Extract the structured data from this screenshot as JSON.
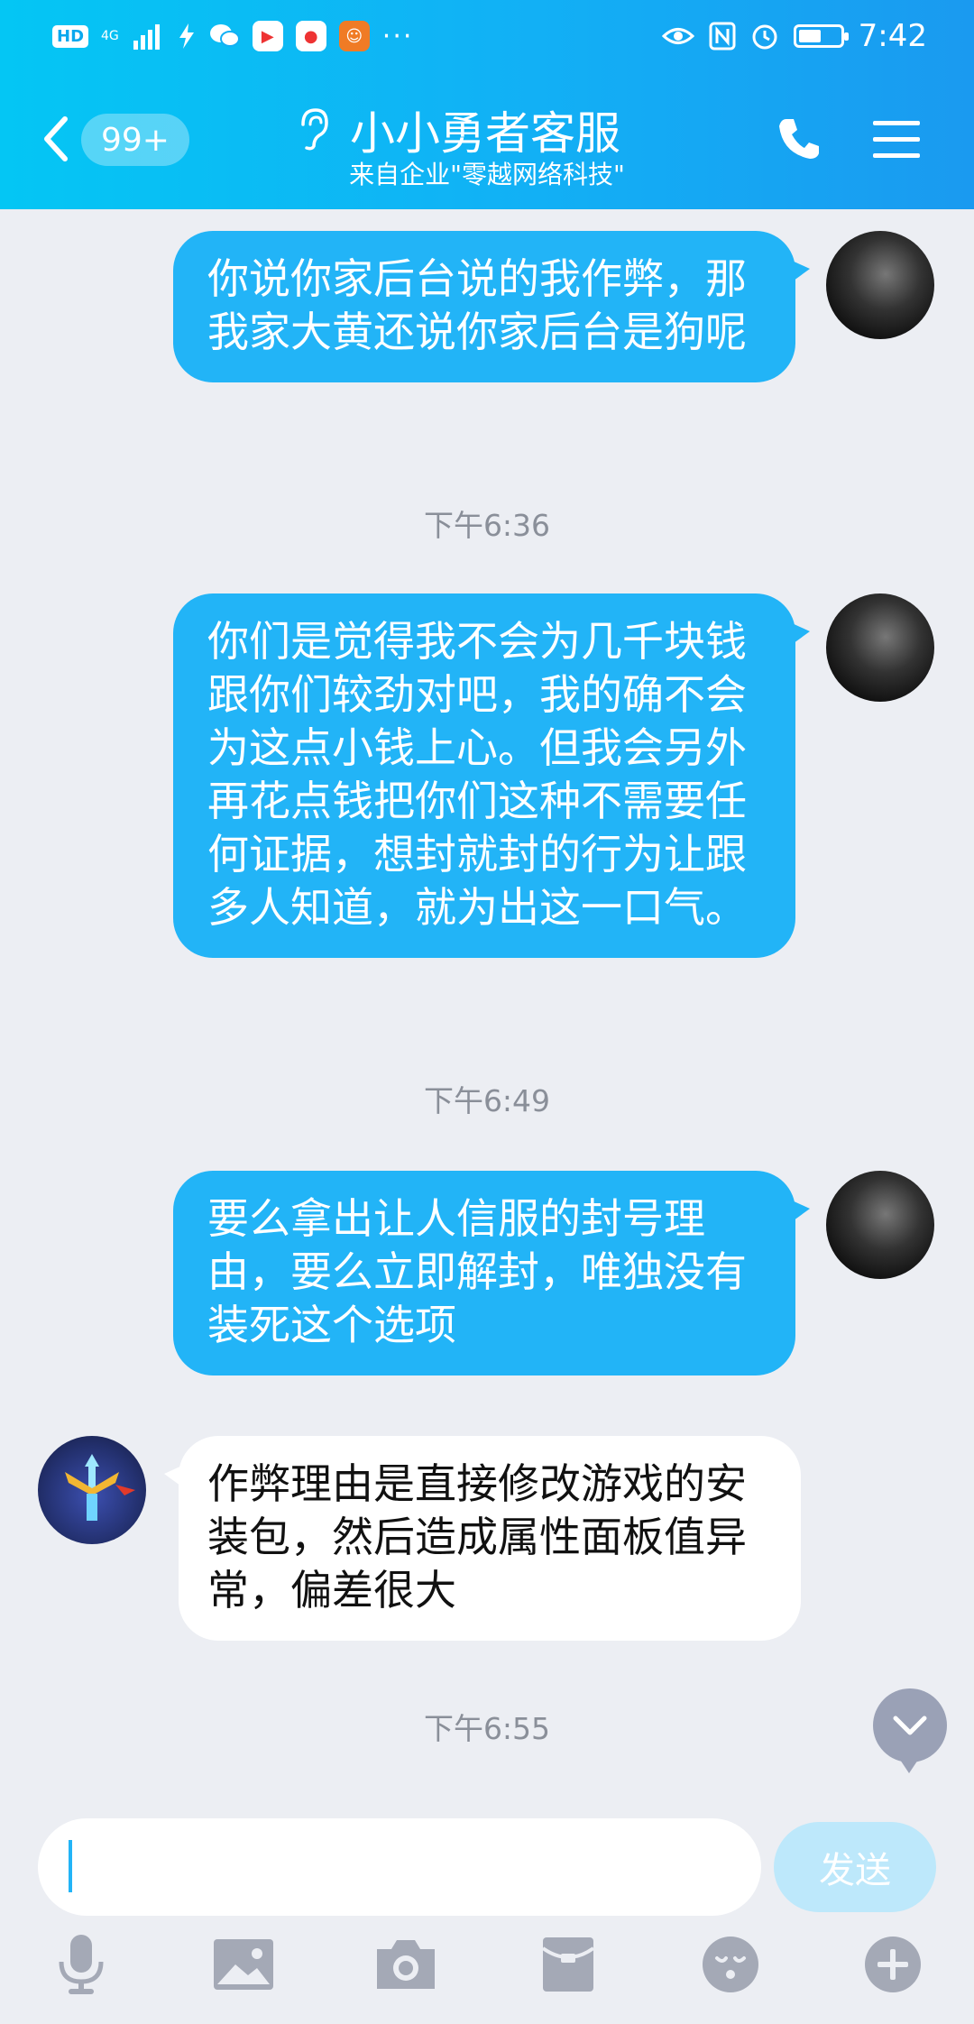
{
  "status_bar": {
    "hd": "HD",
    "network": "4G",
    "time": "7:42",
    "more": "···",
    "battery_level": 0.55
  },
  "header": {
    "unread_badge": "99+",
    "title": "小小勇者客服",
    "subtitle": "来自企业\"零越网络科技\""
  },
  "messages": [
    {
      "type": "outgoing",
      "text": "你说你家后台说的我作弊，那我家大黄还说你家后台是狗呢"
    },
    {
      "type": "time",
      "text": "下午6:36"
    },
    {
      "type": "outgoing",
      "text": "你们是觉得我不会为几千块钱跟你们较劲对吧，我的确不会为这点小钱上心。但我会另外再花点钱把你们这种不需要任何证据，想封就封的行为让跟多人知道，就为出这一口气。"
    },
    {
      "type": "time",
      "text": "下午6:49"
    },
    {
      "type": "outgoing",
      "text": "要么拿出让人信服的封号理由，要么立即解封，唯独没有装死这个选项"
    },
    {
      "type": "incoming",
      "text": "作弊理由是直接修改游戏的安装包，然后造成属性面板值异常，偏差很大"
    },
    {
      "type": "time",
      "text": "下午6:55"
    }
  ],
  "input": {
    "value": "",
    "send_label": "发送"
  },
  "toolbar": {
    "icons": [
      "microphone-icon",
      "image-icon",
      "camera-icon",
      "red-packet-icon",
      "emoji-icon",
      "plus-icon"
    ]
  },
  "colors": {
    "header_start": "#04c6f4",
    "header_end": "#1a9af0",
    "outgoing_bubble": "#22b4f7",
    "incoming_bubble": "#ffffff",
    "background": "#eceef3",
    "send_button": "#bde8fb",
    "icon_gray": "#a4a9b6"
  }
}
